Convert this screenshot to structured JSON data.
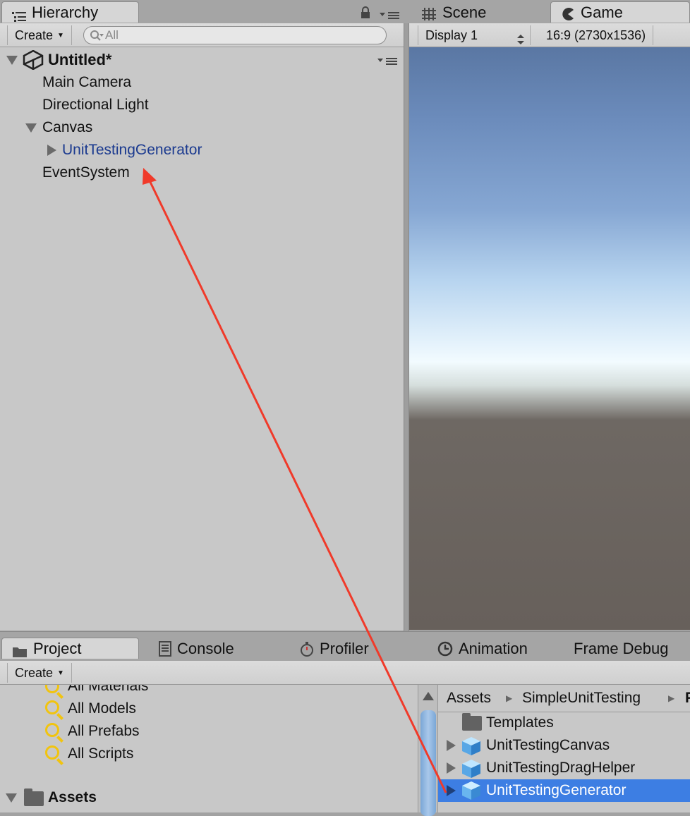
{
  "hierarchy": {
    "tab_label": "Hierarchy",
    "create_label": "Create",
    "search_placeholder": "All",
    "scene_name": "Untitled*",
    "items": [
      {
        "label": "Main Camera"
      },
      {
        "label": "Directional Light"
      },
      {
        "label": "Canvas"
      },
      {
        "label": "UnitTestingGenerator"
      },
      {
        "label": "EventSystem"
      }
    ]
  },
  "game_panel": {
    "tabs": [
      {
        "label": "Scene"
      },
      {
        "label": "Game"
      }
    ],
    "display_label": "Display 1",
    "aspect_label": "16:9 (2730x1536)"
  },
  "project": {
    "tabs": [
      {
        "label": "Project"
      },
      {
        "label": "Console"
      },
      {
        "label": "Profiler"
      },
      {
        "label": "Animation"
      },
      {
        "label": "Frame Debug"
      }
    ],
    "create_label": "Create",
    "favorites": [
      {
        "label": "All Materials"
      },
      {
        "label": "All Models"
      },
      {
        "label": "All Prefabs"
      },
      {
        "label": "All Scripts"
      }
    ],
    "assets_label": "Assets",
    "breadcrumb": [
      "Assets",
      "SimpleUnitTesting",
      "P"
    ],
    "files": [
      {
        "label": "Templates"
      },
      {
        "label": "UnitTestingCanvas"
      },
      {
        "label": "UnitTestingDragHelper"
      },
      {
        "label": "UnitTestingGenerator"
      }
    ]
  },
  "colors": {
    "selection": "#3d7ee3",
    "prefab_text": "#1b3a8f",
    "annotation_arrow": "#f03a2a"
  }
}
